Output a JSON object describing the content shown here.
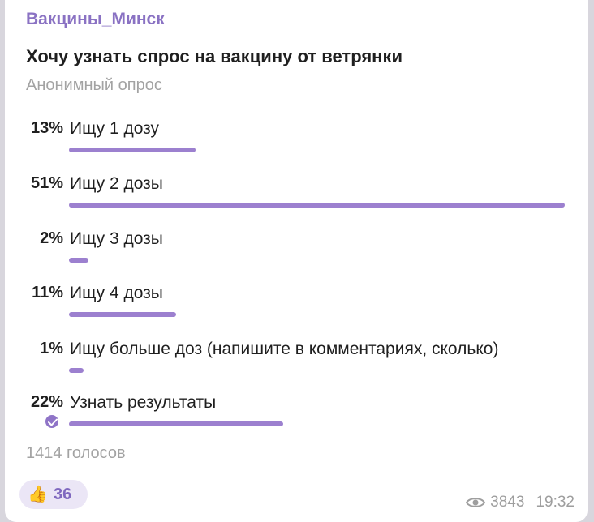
{
  "channel_name": "Вакцины_Минск",
  "poll": {
    "question": "Хочу узнать спрос на вакцину от ветрянки",
    "type_label": "Анонимный опрос",
    "options": [
      {
        "percent": "13%",
        "label": "Ищу 1 дозу",
        "fraction": 0.13,
        "chosen": false
      },
      {
        "percent": "51%",
        "label": "Ищу 2 дозы",
        "fraction": 0.51,
        "chosen": false
      },
      {
        "percent": "2%",
        "label": "Ищу 3 дозы",
        "fraction": 0.02,
        "chosen": false
      },
      {
        "percent": "11%",
        "label": "Ищу 4 дозы",
        "fraction": 0.11,
        "chosen": false
      },
      {
        "percent": "1%",
        "label": "Ищу больше доз (напишите в комментариях, сколько)",
        "fraction": 0.01,
        "chosen": false
      },
      {
        "percent": "22%",
        "label": "Узнать результаты",
        "fraction": 0.22,
        "chosen": true
      }
    ],
    "votes_label": "1414 голосов"
  },
  "reaction": {
    "icon": "thumbs-up-icon",
    "emoji": "👍",
    "count": "36"
  },
  "footer": {
    "views": "3843",
    "time": "19:32",
    "views_icon": "eye-icon"
  },
  "colors": {
    "accent": "#8a72c3",
    "bar": "#9c80cf"
  }
}
